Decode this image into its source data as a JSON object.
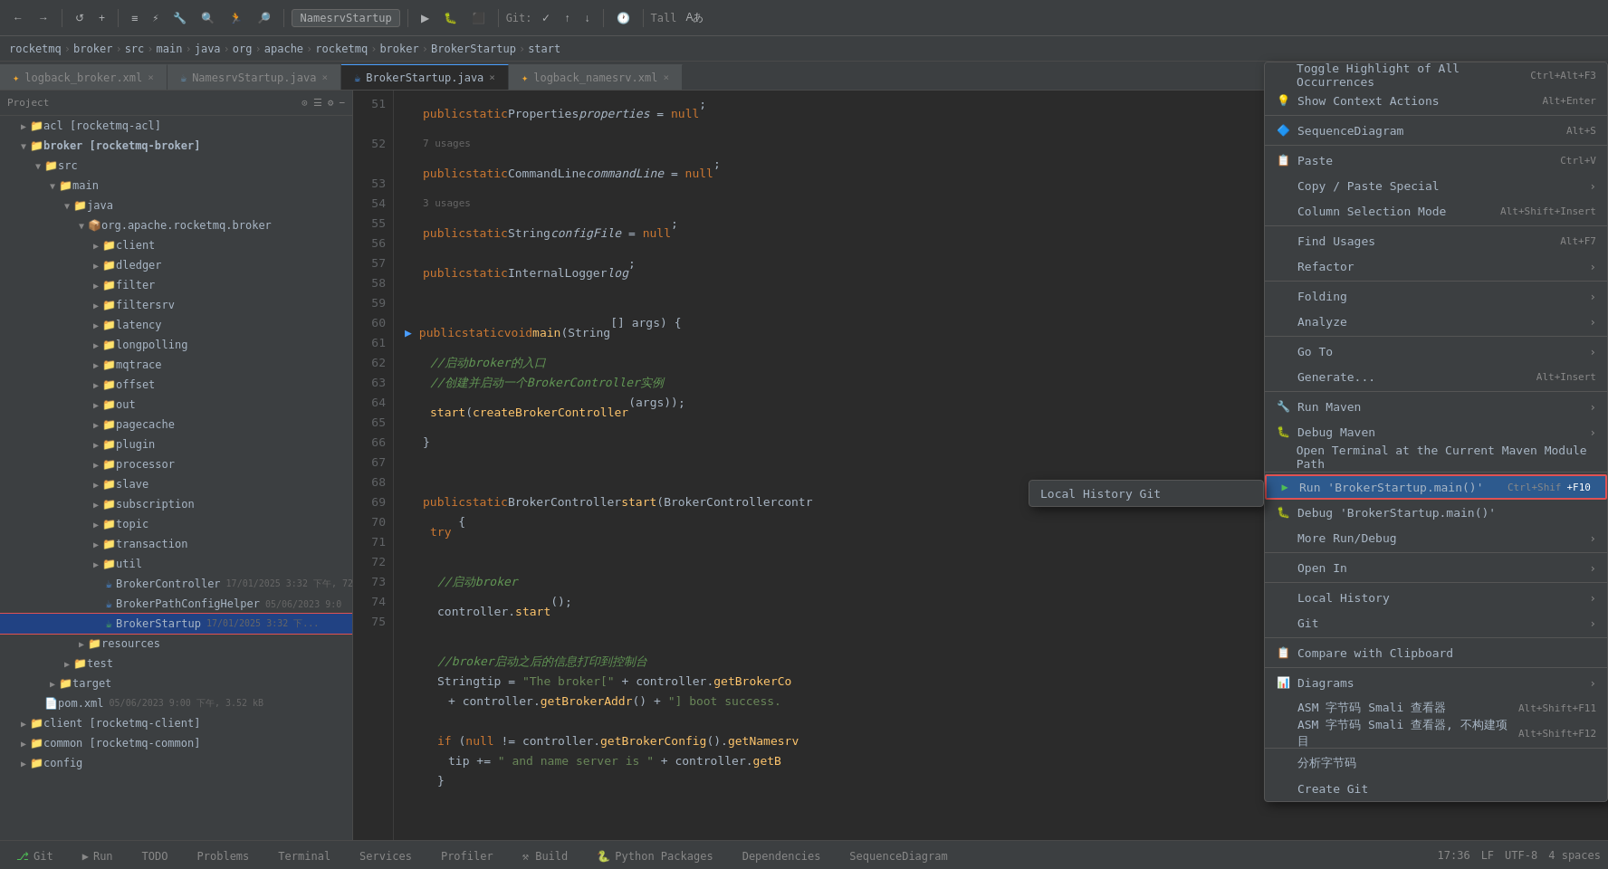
{
  "toolbar": {
    "project_name": "NamesrvStartup",
    "git_label": "Git:",
    "run_label": "Tall"
  },
  "breadcrumb": {
    "parts": [
      "rocketmq",
      "broker",
      "src",
      "main",
      "java",
      "org",
      "apache",
      "rocketmq",
      "broker",
      "BrokerStartup",
      "start"
    ]
  },
  "tabs": [
    {
      "id": "logback_broker",
      "label": "logback_broker.xml",
      "active": false,
      "icon": "xml"
    },
    {
      "id": "namesrv",
      "label": "NamesrvStartup.java",
      "active": false,
      "icon": "java"
    },
    {
      "id": "brokerstartup",
      "label": "BrokerStartup.java",
      "active": true,
      "icon": "java-blue"
    },
    {
      "id": "logback_namesrv",
      "label": "logback_namesrv.xml",
      "active": false,
      "icon": "xml"
    }
  ],
  "sidebar": {
    "header_label": "Project",
    "tree": [
      {
        "indent": 0,
        "arrow": "▶",
        "icon": "📁",
        "label": "acl [rocketmq-acl]",
        "color": "normal"
      },
      {
        "indent": 0,
        "arrow": "▼",
        "icon": "📁",
        "label": "broker [rocketmq-broker]",
        "color": "bold"
      },
      {
        "indent": 1,
        "arrow": "▼",
        "icon": "📁",
        "label": "src",
        "color": "src"
      },
      {
        "indent": 2,
        "arrow": "▼",
        "icon": "📁",
        "label": "main",
        "color": "normal"
      },
      {
        "indent": 3,
        "arrow": "▼",
        "icon": "📁",
        "label": "java",
        "color": "normal"
      },
      {
        "indent": 4,
        "arrow": "▼",
        "icon": "📦",
        "label": "org.apache.rocketmq.broker",
        "color": "normal"
      },
      {
        "indent": 5,
        "arrow": "▶",
        "icon": "📁",
        "label": "client",
        "color": "normal"
      },
      {
        "indent": 5,
        "arrow": "▶",
        "icon": "📁",
        "label": "dledger",
        "color": "normal"
      },
      {
        "indent": 5,
        "arrow": "▶",
        "icon": "📁",
        "label": "filter",
        "color": "normal"
      },
      {
        "indent": 5,
        "arrow": "▶",
        "icon": "📁",
        "label": "filtersrv",
        "color": "normal"
      },
      {
        "indent": 5,
        "arrow": "▶",
        "icon": "📁",
        "label": "latency",
        "color": "normal"
      },
      {
        "indent": 5,
        "arrow": "▶",
        "icon": "📁",
        "label": "longpolling",
        "color": "normal"
      },
      {
        "indent": 5,
        "arrow": "▶",
        "icon": "📁",
        "label": "mqtrace",
        "color": "normal"
      },
      {
        "indent": 5,
        "arrow": "▶",
        "icon": "📁",
        "label": "offset",
        "color": "normal"
      },
      {
        "indent": 5,
        "arrow": "▶",
        "icon": "📁",
        "label": "out",
        "color": "normal"
      },
      {
        "indent": 5,
        "arrow": "▶",
        "icon": "📁",
        "label": "pagecache",
        "color": "normal"
      },
      {
        "indent": 5,
        "arrow": "▶",
        "icon": "📁",
        "label": "plugin",
        "color": "normal"
      },
      {
        "indent": 5,
        "arrow": "▶",
        "icon": "📁",
        "label": "processor",
        "color": "normal"
      },
      {
        "indent": 5,
        "arrow": "▶",
        "icon": "📁",
        "label": "slave",
        "color": "normal"
      },
      {
        "indent": 5,
        "arrow": "▶",
        "icon": "📁",
        "label": "subscription",
        "color": "normal"
      },
      {
        "indent": 5,
        "arrow": "▶",
        "icon": "📁",
        "label": "topic",
        "color": "normal"
      },
      {
        "indent": 5,
        "arrow": "▶",
        "icon": "📁",
        "label": "transaction",
        "color": "normal"
      },
      {
        "indent": 5,
        "arrow": "▶",
        "icon": "📁",
        "label": "util",
        "color": "normal"
      },
      {
        "indent": 5,
        "arrow": "",
        "icon": "☕",
        "label": "BrokerController",
        "meta": "17/01/2025 3:32 下午, 72",
        "color": "normal"
      },
      {
        "indent": 5,
        "arrow": "",
        "icon": "☕",
        "label": "BrokerPathConfigHelper",
        "meta": "05/06/2023 9:0",
        "color": "normal"
      },
      {
        "indent": 5,
        "arrow": "",
        "icon": "☕",
        "label": "BrokerStartup",
        "meta": "17/01/2025 3:32 下...",
        "color": "selected",
        "selected": true
      },
      {
        "indent": 4,
        "arrow": "▶",
        "icon": "📁",
        "label": "resources",
        "color": "normal"
      },
      {
        "indent": 3,
        "arrow": "▶",
        "icon": "📁",
        "label": "test",
        "color": "normal"
      },
      {
        "indent": 2,
        "arrow": "▶",
        "icon": "📁",
        "label": "target",
        "color": "orange"
      },
      {
        "indent": 4,
        "arrow": "",
        "icon": "📄",
        "label": "pom.xml",
        "meta": "05/06/2023 9:00 下午, 3.52 kB",
        "color": "normal"
      },
      {
        "indent": 0,
        "arrow": "▶",
        "icon": "📁",
        "label": "client [rocketmq-client]",
        "color": "normal"
      },
      {
        "indent": 0,
        "arrow": "▶",
        "icon": "📁",
        "label": "common [rocketmq-common]",
        "color": "normal"
      },
      {
        "indent": 0,
        "arrow": "▶",
        "icon": "📁",
        "label": "config",
        "color": "normal"
      }
    ]
  },
  "code_lines": [
    {
      "num": 51,
      "content": "    public static Properties properties = null;",
      "type": "code"
    },
    {
      "num": "",
      "content": "    7 usages",
      "type": "gray"
    },
    {
      "num": 52,
      "content": "    public static CommandLine commandLine = null;",
      "type": "code"
    },
    {
      "num": "",
      "content": "    3 usages",
      "type": "gray"
    },
    {
      "num": 53,
      "content": "    public static String configFile = null;",
      "type": "code"
    },
    {
      "num": 54,
      "content": "    public static InternalLogger log;",
      "type": "code"
    },
    {
      "num": 55,
      "content": "",
      "type": "code"
    },
    {
      "num": 56,
      "content": "    public static void main(String[] args) {",
      "type": "code",
      "runnable": true
    },
    {
      "num": 57,
      "content": "        //启动broker的入口",
      "type": "comment_line"
    },
    {
      "num": 58,
      "content": "        //创建并启动一个BrokerController实例",
      "type": "comment_line"
    },
    {
      "num": 59,
      "content": "        start(createBrokerController(args));",
      "type": "code"
    },
    {
      "num": 60,
      "content": "    }",
      "type": "code"
    },
    {
      "num": 61,
      "content": "",
      "type": "code"
    },
    {
      "num": 62,
      "content": "    public static BrokerController start(BrokerController contr",
      "type": "code"
    },
    {
      "num": 63,
      "content": "        try {",
      "type": "code"
    },
    {
      "num": 64,
      "content": "",
      "type": "code"
    },
    {
      "num": 65,
      "content": "            //启动broker",
      "type": "comment_line"
    },
    {
      "num": 66,
      "content": "            controller.start();",
      "type": "code"
    },
    {
      "num": 67,
      "content": "",
      "type": "code"
    },
    {
      "num": 68,
      "content": "            //broker启动之后的信息打印到控制台",
      "type": "comment_line"
    },
    {
      "num": 69,
      "content": "            String tip = \"The broker[\" + controller.getBrokerCo",
      "type": "code"
    },
    {
      "num": 70,
      "content": "                + controller.getBrokerAddr() + \"] boot success.",
      "type": "code"
    },
    {
      "num": 71,
      "content": "",
      "type": "code"
    },
    {
      "num": 72,
      "content": "            if (null != controller.getBrokerConfig().getNamesrv",
      "type": "code"
    },
    {
      "num": 73,
      "content": "                tip += \" and name server is \" + controller.getB",
      "type": "code"
    },
    {
      "num": 74,
      "content": "            }",
      "type": "code"
    },
    {
      "num": 75,
      "content": "",
      "type": "code"
    }
  ],
  "context_menu": {
    "items": [
      {
        "id": "toggle-highlight",
        "label": "Toggle Highlight of All Occurrences",
        "shortcut": "Ctrl+Alt+F3",
        "icon": "",
        "has_arrow": false,
        "type": "normal"
      },
      {
        "id": "show-context",
        "label": "Show Context Actions",
        "shortcut": "Alt+Enter",
        "icon": "💡",
        "has_arrow": false,
        "type": "normal"
      },
      {
        "id": "sep1",
        "type": "sep"
      },
      {
        "id": "sequence-diagram",
        "label": "SequenceDiagram",
        "shortcut": "Alt+S",
        "icon": "🔷",
        "has_arrow": false,
        "type": "normal"
      },
      {
        "id": "sep2",
        "type": "sep"
      },
      {
        "id": "paste",
        "label": "Paste",
        "shortcut": "Ctrl+V",
        "icon": "📋",
        "has_arrow": false,
        "type": "normal"
      },
      {
        "id": "copy-paste-special",
        "label": "Copy / Paste Special",
        "shortcut": "",
        "icon": "",
        "has_arrow": true,
        "type": "normal"
      },
      {
        "id": "column-selection",
        "label": "Column Selection Mode",
        "shortcut": "Alt+Shift+Insert",
        "icon": "",
        "has_arrow": false,
        "type": "normal"
      },
      {
        "id": "sep3",
        "type": "sep"
      },
      {
        "id": "find-usages",
        "label": "Find Usages",
        "shortcut": "Alt+F7",
        "icon": "",
        "has_arrow": false,
        "type": "normal"
      },
      {
        "id": "refactor",
        "label": "Refactor",
        "shortcut": "",
        "icon": "",
        "has_arrow": true,
        "type": "normal"
      },
      {
        "id": "sep4",
        "type": "sep"
      },
      {
        "id": "folding",
        "label": "Folding",
        "shortcut": "",
        "icon": "",
        "has_arrow": true,
        "type": "normal"
      },
      {
        "id": "analyze",
        "label": "Analyze",
        "shortcut": "",
        "icon": "",
        "has_arrow": true,
        "type": "normal"
      },
      {
        "id": "sep5",
        "type": "sep"
      },
      {
        "id": "goto",
        "label": "Go To",
        "shortcut": "",
        "icon": "",
        "has_arrow": true,
        "type": "normal"
      },
      {
        "id": "generate",
        "label": "Generate...",
        "shortcut": "Alt+Insert",
        "icon": "",
        "has_arrow": false,
        "type": "normal"
      },
      {
        "id": "sep6",
        "type": "sep"
      },
      {
        "id": "run-maven",
        "label": "Run Maven",
        "shortcut": "",
        "icon": "🔧",
        "has_arrow": true,
        "type": "normal"
      },
      {
        "id": "debug-maven",
        "label": "Debug Maven",
        "shortcut": "",
        "icon": "🐛",
        "has_arrow": true,
        "type": "normal"
      },
      {
        "id": "open-terminal",
        "label": "Open Terminal at the Current Maven Module Path",
        "shortcut": "",
        "icon": "",
        "has_arrow": false,
        "type": "normal"
      },
      {
        "id": "sep7",
        "type": "sep"
      },
      {
        "id": "run-broker",
        "label": "Run 'BrokerStartup.main()'",
        "shortcut": "Ctrl+Shif",
        "shortcut2": "+F10",
        "icon": "▶",
        "has_arrow": false,
        "type": "run_highlighted"
      },
      {
        "id": "debug-broker",
        "label": "Debug 'BrokerStartup.main()'",
        "shortcut": "",
        "icon": "🐛",
        "has_arrow": false,
        "type": "normal"
      },
      {
        "id": "more-run-debug",
        "label": "More Run/Debug",
        "shortcut": "",
        "icon": "",
        "has_arrow": true,
        "type": "normal"
      },
      {
        "id": "sep8",
        "type": "sep"
      },
      {
        "id": "open-in",
        "label": "Open In",
        "shortcut": "",
        "icon": "",
        "has_arrow": true,
        "type": "normal"
      },
      {
        "id": "sep9",
        "type": "sep"
      },
      {
        "id": "local-history",
        "label": "Local History",
        "shortcut": "",
        "icon": "",
        "has_arrow": true,
        "type": "normal"
      },
      {
        "id": "git",
        "label": "Git",
        "shortcut": "",
        "icon": "",
        "has_arrow": true,
        "type": "normal"
      },
      {
        "id": "sep10",
        "type": "sep"
      },
      {
        "id": "compare-clipboard",
        "label": "Compare with Clipboard",
        "shortcut": "",
        "icon": "📋",
        "has_arrow": false,
        "type": "normal"
      },
      {
        "id": "sep11",
        "type": "sep"
      },
      {
        "id": "diagrams",
        "label": "Diagrams",
        "shortcut": "",
        "icon": "📊",
        "has_arrow": true,
        "type": "normal"
      },
      {
        "id": "asm-smali",
        "label": "ASM 字节码 Smali 查看器",
        "shortcut": "Alt+Shift+F11",
        "icon": "",
        "has_arrow": false,
        "type": "normal"
      },
      {
        "id": "asm-smali2",
        "label": "ASM 字节码 Smali 查看器, 不构建项目",
        "shortcut": "Alt+Shift+F12",
        "icon": "",
        "has_arrow": false,
        "type": "normal"
      },
      {
        "id": "sep12",
        "type": "sep"
      },
      {
        "id": "analyze-str",
        "label": "分析字节码",
        "shortcut": "",
        "icon": "",
        "has_arrow": false,
        "type": "normal"
      },
      {
        "id": "create-git",
        "label": "Create Git",
        "shortcut": "",
        "icon": "",
        "has_arrow": false,
        "type": "normal"
      }
    ]
  },
  "submenu": {
    "title": "Local History / Git",
    "items": [
      {
        "label": "Local History Git"
      }
    ]
  },
  "bottom_tabs": [
    {
      "id": "git",
      "label": "Git",
      "icon": "branch",
      "active": false
    },
    {
      "id": "run",
      "label": "Run",
      "icon": "play",
      "active": false
    },
    {
      "id": "todo",
      "label": "TODO",
      "icon": "",
      "active": false
    },
    {
      "id": "problems",
      "label": "Problems",
      "icon": "",
      "active": false
    },
    {
      "id": "terminal",
      "label": "Terminal",
      "icon": "",
      "active": false
    },
    {
      "id": "services",
      "label": "Services",
      "icon": "",
      "active": false
    },
    {
      "id": "profiler",
      "label": "Profiler",
      "icon": "",
      "active": false
    },
    {
      "id": "build",
      "label": "Build",
      "icon": "",
      "active": false
    },
    {
      "id": "python-packages",
      "label": "Python Packages",
      "icon": "",
      "active": false
    },
    {
      "id": "dependencies",
      "label": "Dependencies",
      "icon": "",
      "active": false
    },
    {
      "id": "sequence-diagram",
      "label": "SequenceDiagram",
      "icon": "",
      "active": false
    }
  ],
  "status_bar": {
    "line_col": "17:36",
    "encoding": "UTF-8",
    "lf": "LF",
    "indent": "4 spaces"
  }
}
